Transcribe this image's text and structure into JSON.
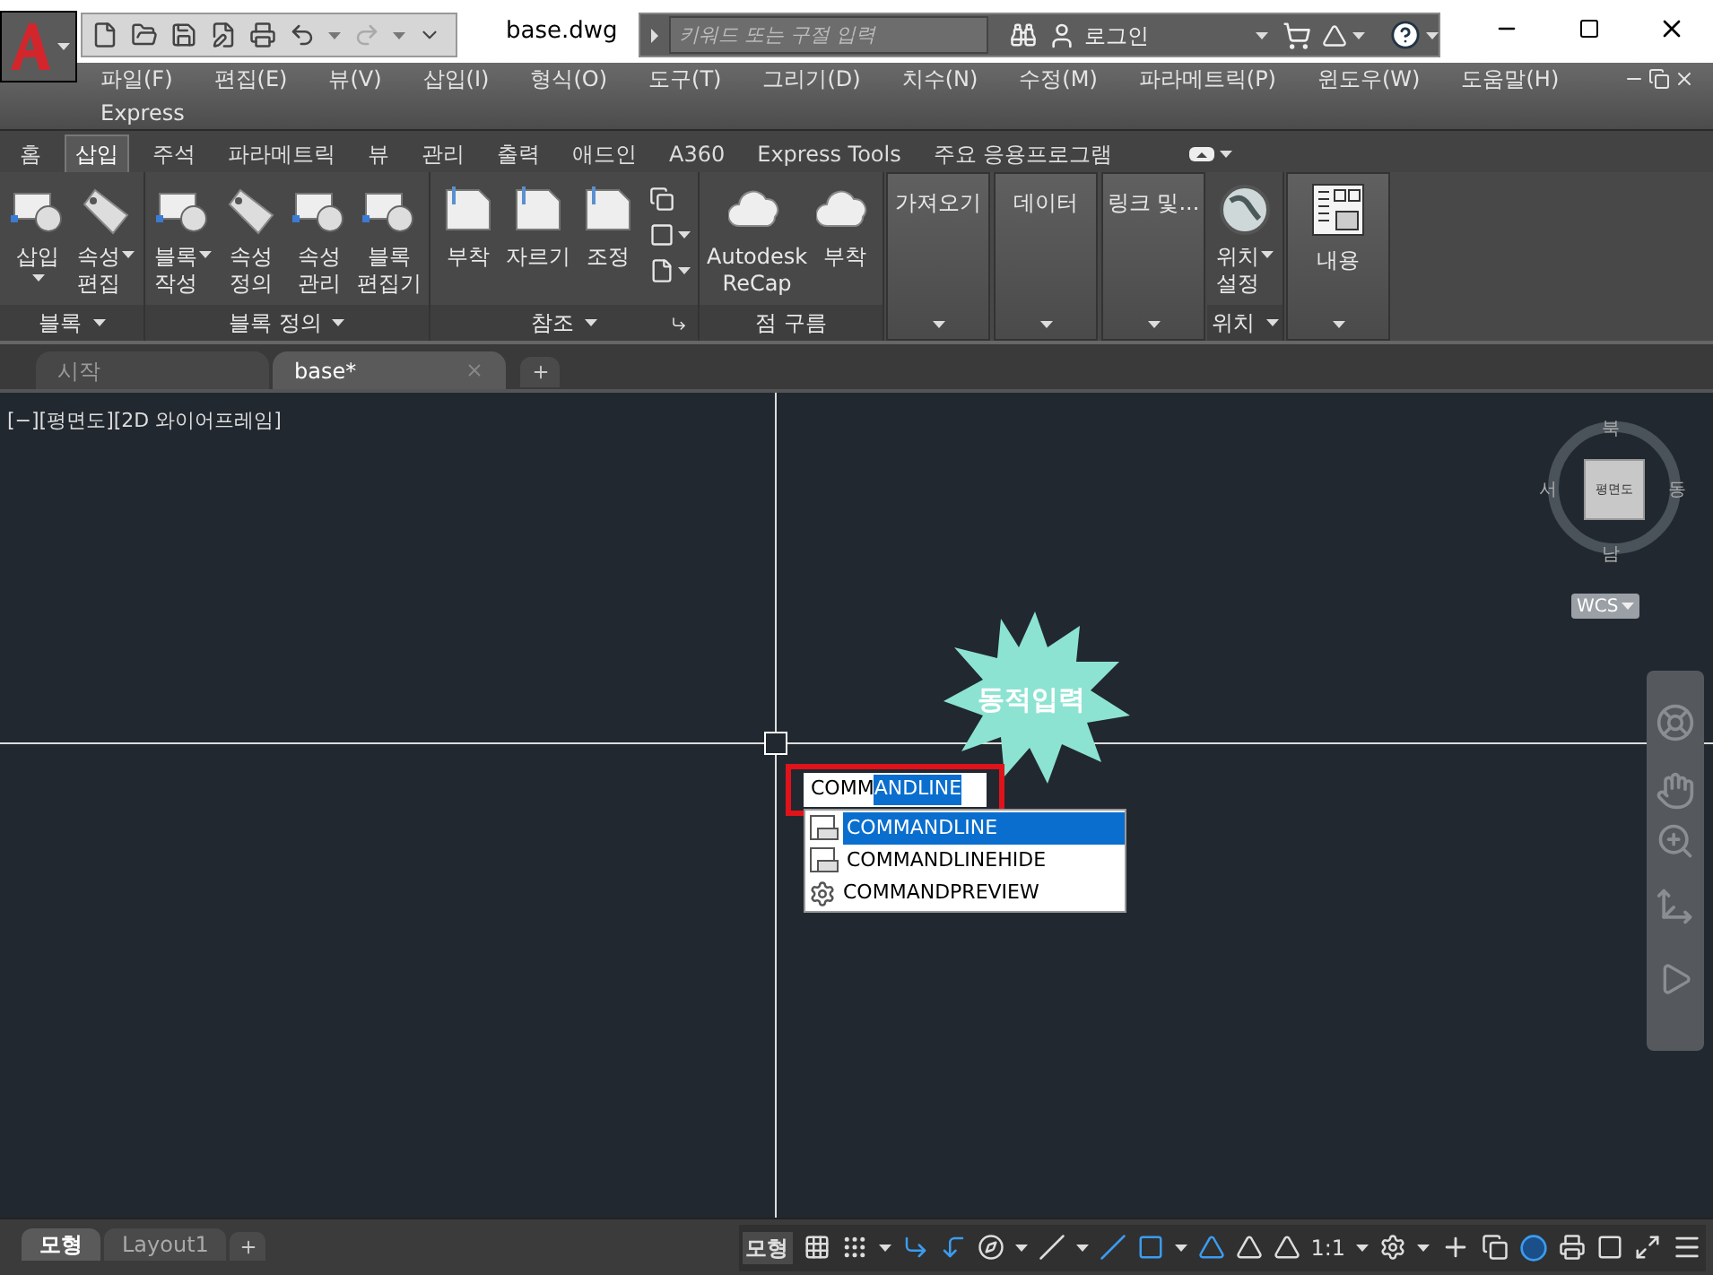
{
  "title_bar": {
    "title": "base.dwg",
    "search": {
      "placeholder": "키워드 또는 구절 입력"
    },
    "login": "로그인"
  },
  "menu_bar": {
    "items": [
      "파일(F)",
      "편집(E)",
      "뷰(V)",
      "삽입(I)",
      "형식(O)",
      "도구(T)",
      "그리기(D)",
      "치수(N)",
      "수정(M)",
      "파라메트릭(P)",
      "윈도우(W)",
      "도움말(H)"
    ],
    "second_row": [
      "Express"
    ]
  },
  "ribbon_tabs": [
    {
      "label": "홈",
      "selected": false
    },
    {
      "label": "삽입",
      "selected": true
    },
    {
      "label": "주석",
      "selected": false
    },
    {
      "label": "파라메트릭",
      "selected": false
    },
    {
      "label": "뷰",
      "selected": false
    },
    {
      "label": "관리",
      "selected": false
    },
    {
      "label": "출력",
      "selected": false
    },
    {
      "label": "애드인",
      "selected": false
    },
    {
      "label": "A360",
      "selected": false
    },
    {
      "label": "Express Tools",
      "selected": false
    },
    {
      "label": "주요 응용프로그램",
      "selected": false
    }
  ],
  "ribbon_panels": [
    {
      "kind": "tools",
      "title": "블록",
      "tools": [
        {
          "lines": [
            "삽입"
          ],
          "dropdown": true
        },
        {
          "lines": [
            "속성",
            "편집"
          ],
          "dropdown": true
        }
      ]
    },
    {
      "kind": "tools",
      "title": "블록 정의",
      "tools": [
        {
          "lines": [
            "블록",
            "작성"
          ],
          "dropdown": true
        },
        {
          "lines": [
            "속성",
            "정의"
          ],
          "dropdown": false
        },
        {
          "lines": [
            "속성",
            "관리"
          ],
          "dropdown": false
        },
        {
          "lines": [
            "블록",
            "편집기"
          ],
          "dropdown": false
        }
      ]
    },
    {
      "kind": "tools",
      "title": "참조",
      "launcher": true,
      "tools": [
        {
          "lines": [
            "부착"
          ],
          "dropdown": false
        },
        {
          "lines": [
            "자르기"
          ],
          "dropdown": false
        },
        {
          "lines": [
            "조정"
          ],
          "dropdown": false
        }
      ]
    },
    {
      "kind": "tools",
      "title": "점 구름",
      "tools": [
        {
          "lines": [
            "Autodesk",
            "ReCap"
          ],
          "dropdown": false
        },
        {
          "lines": [
            "부착"
          ],
          "dropdown": false
        }
      ]
    },
    {
      "kind": "collapsed",
      "title": "가져오기"
    },
    {
      "kind": "collapsed",
      "title": "데이터"
    },
    {
      "kind": "collapsed",
      "title": "링크 및..."
    },
    {
      "kind": "tools",
      "title": "위치",
      "tools": [
        {
          "lines": [
            "위치",
            "설정"
          ],
          "dropdown": true
        }
      ]
    },
    {
      "kind": "collapsed-icon",
      "title": "내용"
    }
  ],
  "file_tabs": [
    {
      "label": "시작",
      "selected": false
    },
    {
      "label": "base*",
      "selected": true
    }
  ],
  "viewport": {
    "label": "[−][평면도][2D 와이어프레임]",
    "viewcube": {
      "north": "북",
      "west": "서",
      "east": "동",
      "south": "남",
      "face": "평면도",
      "ucs": "WCS"
    },
    "callout": "동적입력",
    "command_input": {
      "typed": "COMM",
      "highlighted": "ANDLINE"
    },
    "suggestions": [
      {
        "label": "COMMANDLINE",
        "selected": true
      },
      {
        "label": "COMMANDLINEHIDE",
        "selected": false
      },
      {
        "label": "COMMANDPREVIEW",
        "selected": false
      }
    ]
  },
  "layout_tabs": [
    {
      "label": "모형",
      "selected": true
    },
    {
      "label": "Layout1",
      "selected": false
    }
  ],
  "status_bar": {
    "space": "모형",
    "scale": "1:1"
  }
}
